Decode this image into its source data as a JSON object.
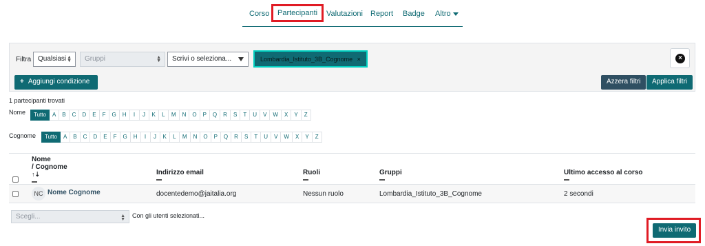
{
  "nav": {
    "tabs": [
      "Corso",
      "Partecipanti",
      "Valutazioni",
      "Report",
      "Badge",
      "Altro"
    ],
    "active": "Partecipanti"
  },
  "filter": {
    "label": "Filtra",
    "match_value": "Qualsiasi",
    "type_value": "Gruppi",
    "search_placeholder": "Scrivi o seleziona...",
    "chip_label": "Lombardia_Istituto_3B_Cognome",
    "chip_remove": "×",
    "add_condition": "Aggiungi condizione",
    "add_icon": "+",
    "reset": "Azzera filtri",
    "apply": "Applica filtri"
  },
  "result_count": "1 partecipanti trovati",
  "initials": {
    "first_label": "Nome",
    "last_label": "Cognome",
    "all": "Tutto",
    "letters": [
      "A",
      "B",
      "C",
      "D",
      "E",
      "F",
      "G",
      "H",
      "I",
      "J",
      "K",
      "L",
      "M",
      "N",
      "O",
      "P",
      "Q",
      "R",
      "S",
      "T",
      "U",
      "V",
      "W",
      "X",
      "Y",
      "Z"
    ]
  },
  "table": {
    "headers": {
      "name_line1": "Nome",
      "name_line2": "/ Cognome",
      "email": "Indirizzo email",
      "roles": "Ruoli",
      "groups": "Gruppi",
      "last_access": "Ultimo accesso al corso"
    },
    "rows": [
      {
        "initials": "NC",
        "name": "Nome Cognome",
        "email": "docentedemo@jaitalia.org",
        "roles": "Nessun ruolo",
        "groups": "Lombardia_Istituto_3B_Cognome",
        "last_access": "2 secondi"
      }
    ]
  },
  "bulk": {
    "select_placeholder": "Scegli...",
    "with_selected": "Con gli utenti selezionati...",
    "invite": "Invia invito"
  },
  "colors": {
    "accent": "#0f6a73",
    "highlight": "#e01b24"
  }
}
